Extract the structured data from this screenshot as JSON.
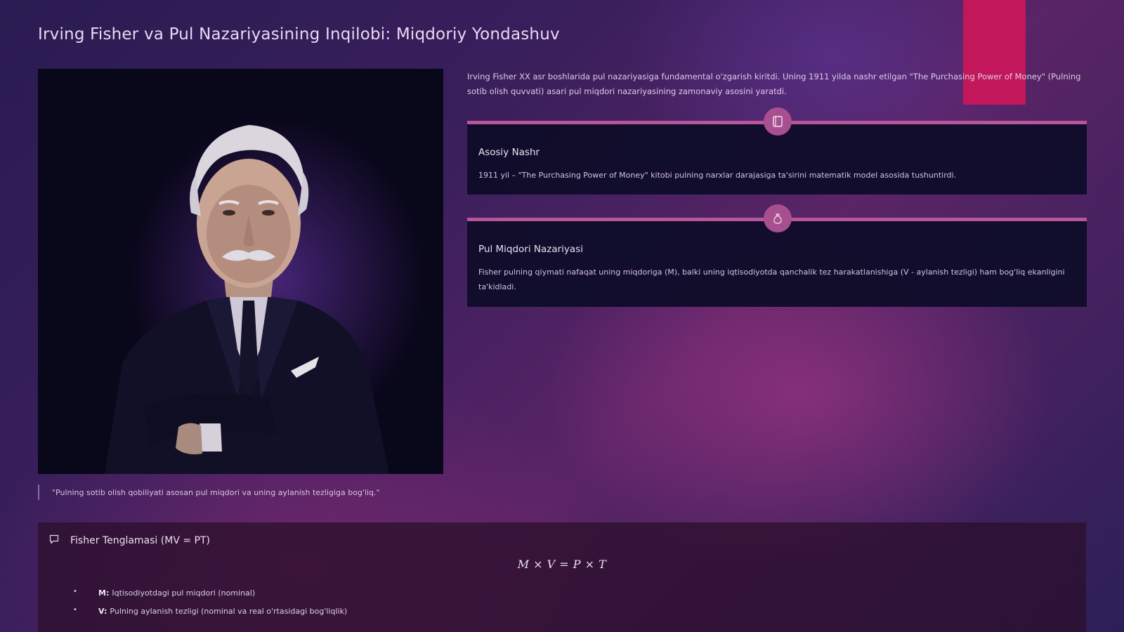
{
  "page": {
    "title": "Irving Fisher va Pul Nazariyasining Inqilobi: Miqdoriy Yondashuv"
  },
  "colors": {
    "accent": "#c2185b",
    "timeline": "#b8569a",
    "card_background": "#0e0c28"
  },
  "portrait": {
    "quote": "\"Pulning sotib olish qobiliyati asosan pul miqdori va uning aylanish tezligiga bog'liq.\""
  },
  "intro": {
    "text": "Irving Fisher XX asr boshlarida pul nazariyasiga fundamental o'zgarish kiritdi. Uning 1911 yilda nashr etilgan \"The Purchasing Power of Money\" (Pulning sotib olish quvvati) asari pul miqdori nazariyasining zamonaviy asosini yaratdi."
  },
  "cards": [
    {
      "icon": "book-icon",
      "title": "Asosiy Nashr",
      "text": "1911 yil – \"The Purchasing Power of Money\" kitobi pulning narxlar darajasiga ta'sirini matematik model asosida tushuntirdi."
    },
    {
      "icon": "money-bag-icon",
      "title": "Pul Miqdori Nazariyasi",
      "text": "Fisher pulning qiymati nafaqat uning miqdoriga (M), balki uning iqtisodiyotda qanchalik tez harakatlanishiga (V - aylanish tezligi) ham bog'liq ekanligini ta'kidladi."
    }
  ],
  "equation": {
    "icon": "chat-bubble-icon",
    "title": "Fisher Tenglamasi (MV = PT)",
    "formula": "M × V = P × T",
    "items": [
      {
        "term": "M:",
        "text": "Iqtisodiyotdagi pul miqdori (nominal)"
      },
      {
        "term": "V:",
        "text": "Pulning aylanish tezligi (nominal va real o'rtasidagi bog'liqlik)"
      }
    ]
  }
}
